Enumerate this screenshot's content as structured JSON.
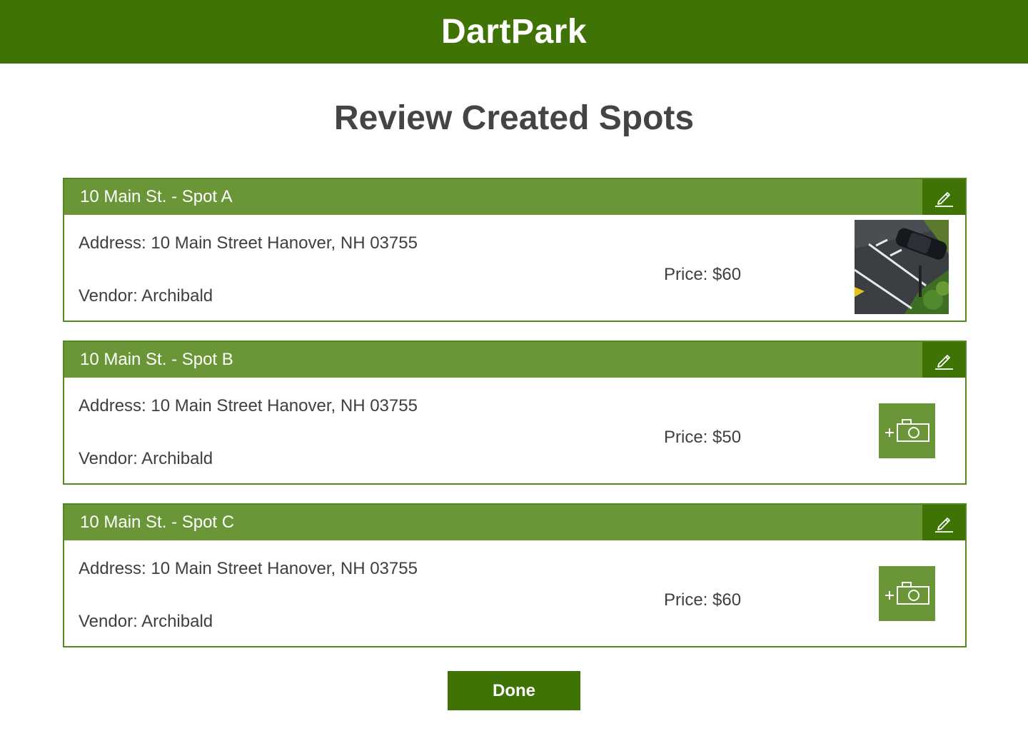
{
  "app": {
    "title": "DartPark"
  },
  "page": {
    "title": "Review Created Spots"
  },
  "spots": [
    {
      "title": "10 Main St. - Spot A",
      "address": "Address: 10 Main Street Hanover, NH 03755",
      "vendor": "Vendor: Archibald",
      "price": "Price: $60",
      "has_photo": true
    },
    {
      "title": "10 Main St. - Spot B",
      "address": "Address: 10 Main Street Hanover, NH 03755",
      "vendor": "Vendor: Archibald",
      "price": "Price: $50",
      "has_photo": false
    },
    {
      "title": "10 Main St. - Spot C",
      "address": "Address: 10 Main Street Hanover, NH 03755",
      "vendor": "Vendor: Archibald",
      "price": "Price: $60",
      "has_photo": false
    }
  ],
  "actions": {
    "done_label": "Done"
  },
  "icons": {
    "edit": "pencil-icon",
    "add_photo": "add-camera-icon"
  },
  "colors": {
    "brand": "#3f7305",
    "header": "#6a9637",
    "border": "#4e8a1e"
  }
}
